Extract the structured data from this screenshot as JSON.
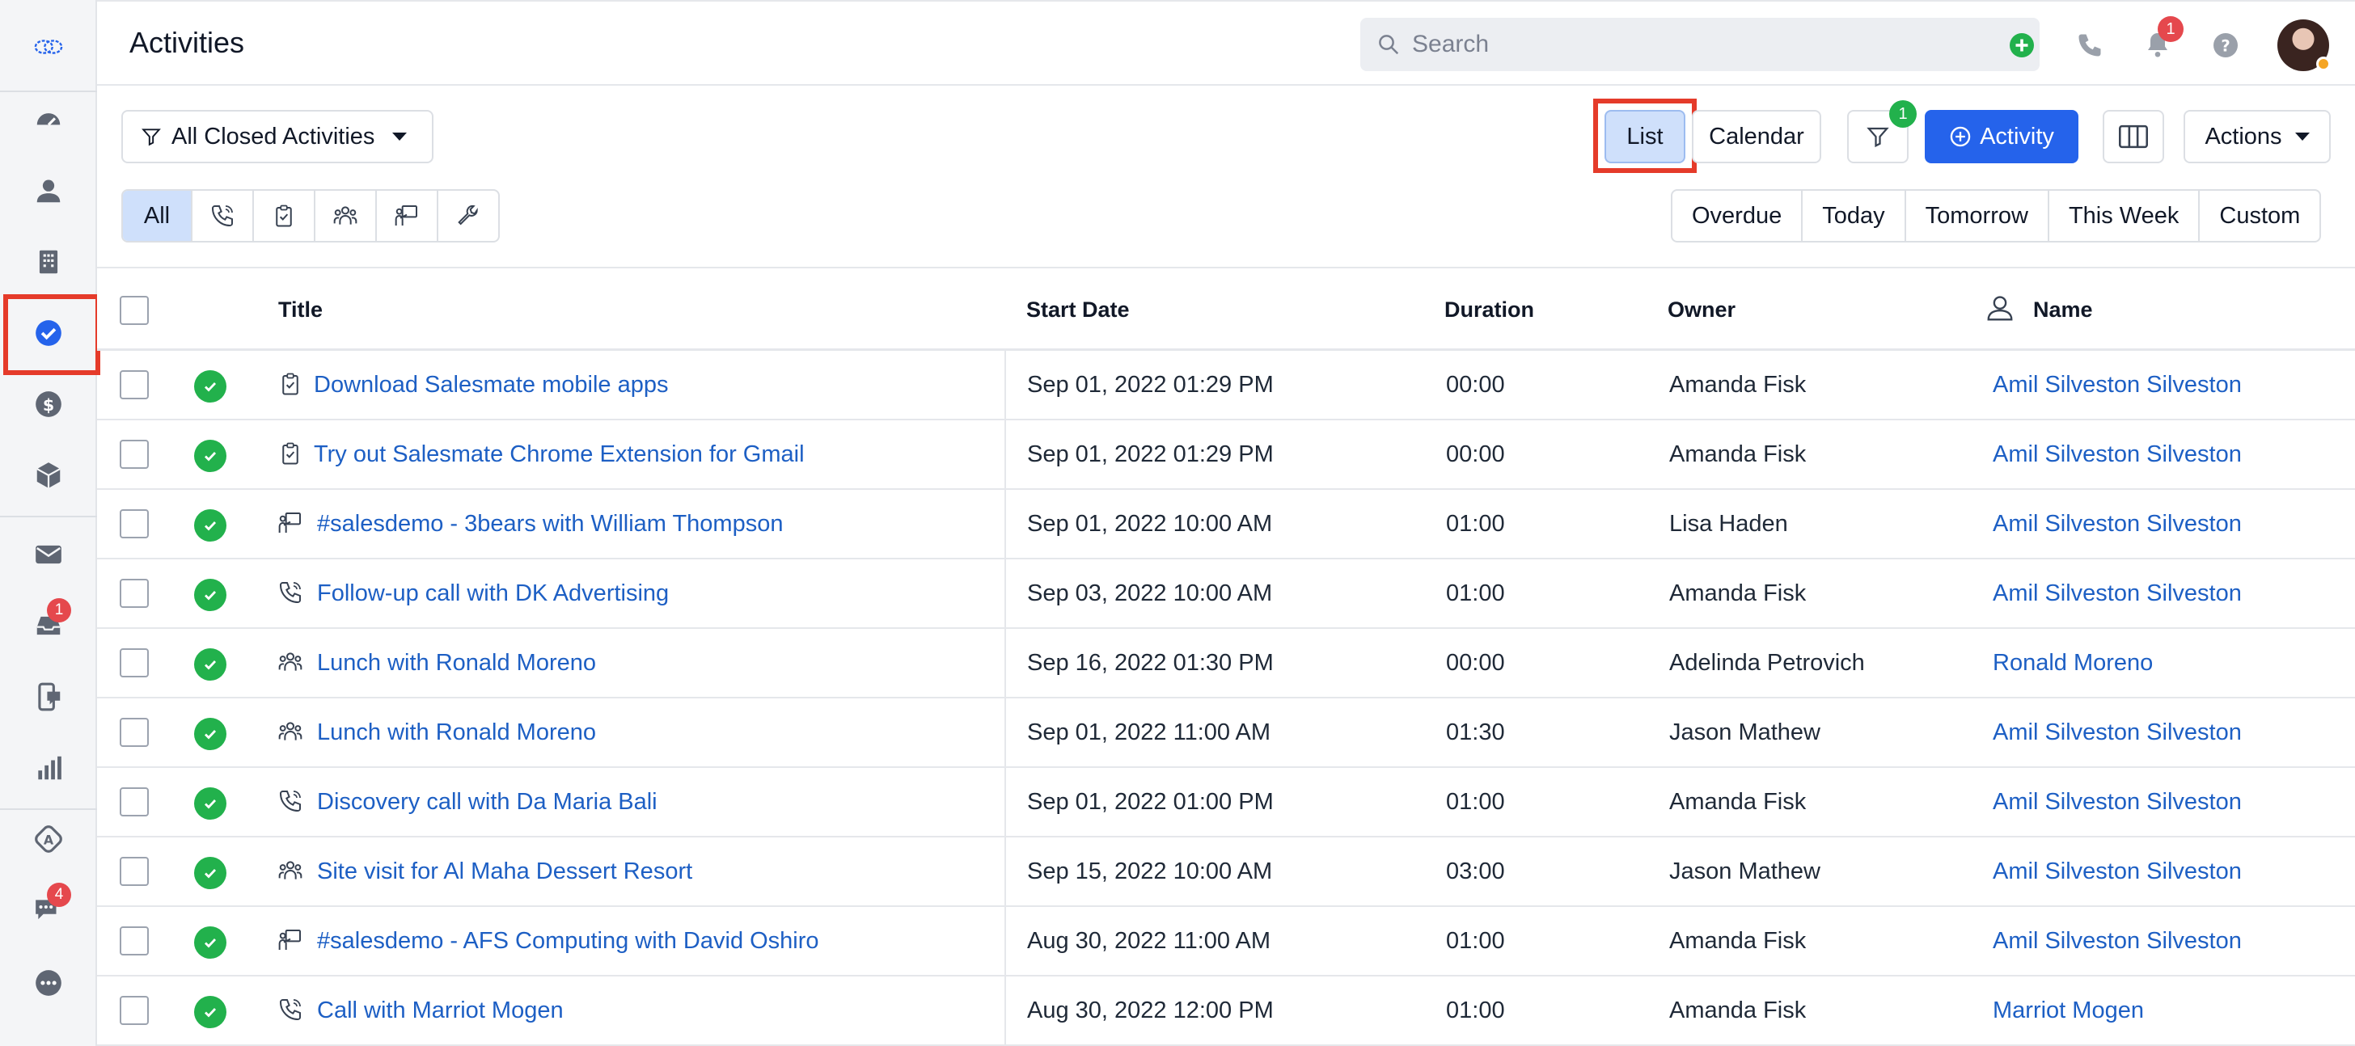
{
  "header": {
    "title": "Activities",
    "search_placeholder": "Search",
    "notification_count": "1"
  },
  "sidebar": {
    "items": [
      {
        "name": "dashboard",
        "icon": "gauge-icon"
      },
      {
        "name": "contacts",
        "icon": "person-icon"
      },
      {
        "name": "companies",
        "icon": "building-icon"
      },
      {
        "name": "activities",
        "icon": "check-circle-icon",
        "active": true
      },
      {
        "name": "deals",
        "icon": "dollar-icon"
      },
      {
        "name": "products",
        "icon": "cube-icon"
      },
      {
        "name": "email",
        "icon": "mail-icon"
      },
      {
        "name": "inbox",
        "icon": "inbox-icon",
        "badge": "1"
      },
      {
        "name": "sms",
        "icon": "phone-chat-icon"
      },
      {
        "name": "reports",
        "icon": "bar-chart-icon"
      },
      {
        "name": "automation",
        "icon": "automation-icon"
      },
      {
        "name": "chat",
        "icon": "chat-icon",
        "badge": "4"
      },
      {
        "name": "more",
        "icon": "more-icon"
      }
    ]
  },
  "toolbar": {
    "view_filter": "All Closed Activities",
    "list_label": "List",
    "calendar_label": "Calendar",
    "filter_badge": "1",
    "add_activity_label": "Activity",
    "actions_label": "Actions",
    "type_all_label": "All",
    "date_filters": [
      "Overdue",
      "Today",
      "Tomorrow",
      "This Week",
      "Custom"
    ]
  },
  "table": {
    "columns": {
      "title": "Title",
      "start_date": "Start Date",
      "duration": "Duration",
      "owner": "Owner",
      "name": "Name"
    },
    "rows": [
      {
        "type": "task",
        "title": "Download Salesmate mobile apps",
        "start_date": "Sep 01, 2022 01:29 PM",
        "duration": "00:00",
        "owner": "Amanda Fisk",
        "name": "Amil Silveston Silveston"
      },
      {
        "type": "task",
        "title": "Try out Salesmate Chrome Extension for Gmail",
        "start_date": "Sep 01, 2022 01:29 PM",
        "duration": "00:00",
        "owner": "Amanda Fisk",
        "name": "Amil Silveston Silveston"
      },
      {
        "type": "demo",
        "title": "#salesdemo - 3bears with William Thompson",
        "start_date": "Sep 01, 2022 10:00 AM",
        "duration": "01:00",
        "owner": "Lisa Haden",
        "name": "Amil Silveston Silveston"
      },
      {
        "type": "call",
        "title": "Follow-up call with DK Advertising",
        "start_date": "Sep 03, 2022 10:00 AM",
        "duration": "01:00",
        "owner": "Amanda Fisk",
        "name": "Amil Silveston Silveston"
      },
      {
        "type": "meeting",
        "title": "Lunch with Ronald Moreno",
        "start_date": "Sep 16, 2022 01:30 PM",
        "duration": "00:00",
        "owner": "Adelinda Petrovich",
        "name": "Ronald Moreno"
      },
      {
        "type": "meeting",
        "title": "Lunch with Ronald Moreno",
        "start_date": "Sep 01, 2022 11:00 AM",
        "duration": "01:30",
        "owner": "Jason Mathew",
        "name": "Amil Silveston Silveston"
      },
      {
        "type": "call",
        "title": "Discovery call with Da Maria Bali",
        "start_date": "Sep 01, 2022 01:00 PM",
        "duration": "01:00",
        "owner": "Amanda Fisk",
        "name": "Amil Silveston Silveston"
      },
      {
        "type": "meeting",
        "title": "Site visit for Al Maha Dessert Resort",
        "start_date": "Sep 15, 2022 10:00 AM",
        "duration": "03:00",
        "owner": "Jason Mathew",
        "name": "Amil Silveston Silveston"
      },
      {
        "type": "demo",
        "title": "#salesdemo - AFS Computing with David Oshiro",
        "start_date": "Aug 30, 2022 11:00 AM",
        "duration": "01:00",
        "owner": "Amanda Fisk",
        "name": "Amil Silveston Silveston"
      },
      {
        "type": "call",
        "title": "Call with Marriot Mogen",
        "start_date": "Aug 30, 2022 12:00 PM",
        "duration": "01:00",
        "owner": "Amanda Fisk",
        "name": "Marriot Mogen"
      }
    ]
  },
  "colors": {
    "accent": "#2563eb",
    "link": "#1d5fc4",
    "success": "#22b14c",
    "badge": "#e5484d",
    "highlight": "#e53b2a"
  }
}
